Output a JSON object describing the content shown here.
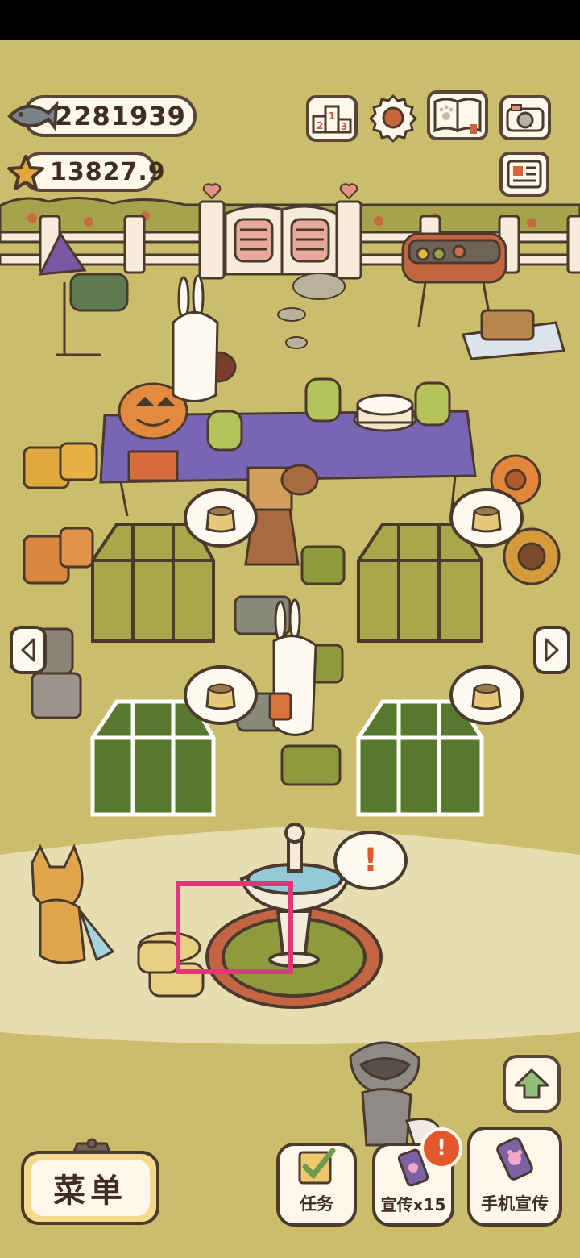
{
  "hud": {
    "fish_count": "2281939",
    "star_count": "13827.9"
  },
  "toolbar": {
    "ranking_icon": "ranking-podium-icon",
    "settings_icon": "gear-icon",
    "album_icon": "paw-book-icon",
    "camera_icon": "camera-icon",
    "profile_icon": "profile-card-icon"
  },
  "bottom_bar": {
    "menu_label": "菜单",
    "tasks_label": "任务",
    "promo_label": "宣传x15",
    "phone_promo_label": "手机宣传",
    "alert_mark": "!"
  },
  "fountain_bubble": {
    "mark": "!"
  },
  "colors": {
    "grass": "#cbbd6c",
    "path": "#e7ddb0",
    "outline": "#4a3a2e",
    "highlight": "#e0367a",
    "alert": "#e2582a"
  }
}
